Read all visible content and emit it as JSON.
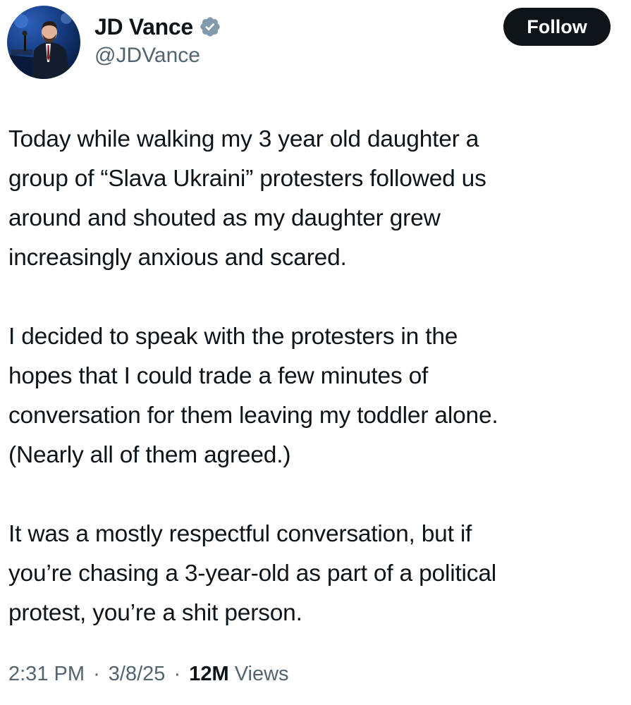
{
  "author": {
    "display_name": "JD Vance",
    "handle": "@JDVance",
    "verified_icon": "verified-badge-icon",
    "verified_color": "#829aab"
  },
  "follow_button": {
    "label": "Follow",
    "background": "#0f1419",
    "text_color": "#ffffff"
  },
  "tweet": {
    "paragraphs": [
      "Today while walking my 3 year old daughter a\ngroup of “Slava Ukraini” protesters followed us\naround and shouted as my daughter grew\nincreasingly anxious and scared.",
      "I decided to speak with the protesters in the\nhopes that I could trade a few minutes of\nconversation for them leaving my toddler alone.\n(Nearly all of them agreed.)",
      "It was a mostly respectful conversation,  but if\nyou’re chasing a 3-year-old as part of a political\nprotest, you’re a shit person."
    ]
  },
  "meta": {
    "time": "2:31 PM",
    "date": "3/8/25",
    "separator": "·",
    "views_count": "12M",
    "views_label": "Views"
  }
}
